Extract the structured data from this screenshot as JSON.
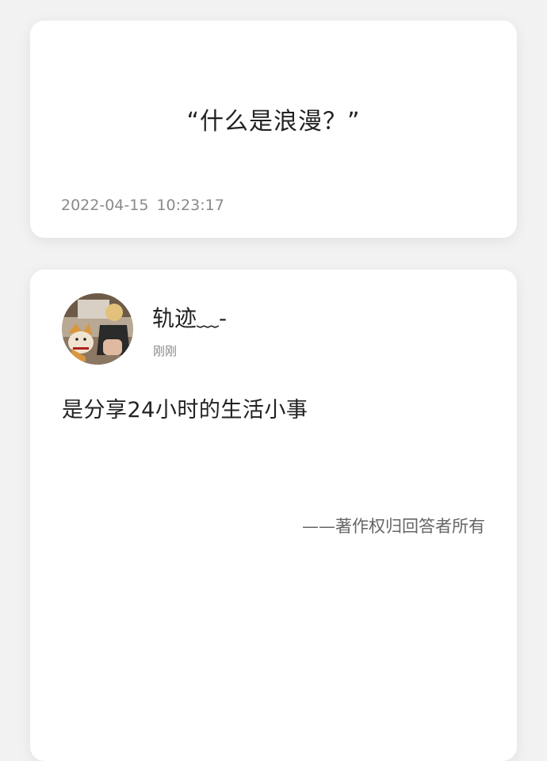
{
  "question": {
    "text": "“什么是浪漫？”",
    "timestamp": "2022-04-15  10:23:17"
  },
  "answer": {
    "author": {
      "name": "轨迹﹏-",
      "time": "刚刚",
      "avatar_icon": "avatar-photo-with-dog"
    },
    "text": "是分享24小时的生活小事",
    "copyright": "——著作权归回答者所有"
  },
  "colors": {
    "background": "#f2f2f2",
    "card": "#ffffff",
    "primary_text": "#222222",
    "secondary_text": "#8a8a8a"
  }
}
